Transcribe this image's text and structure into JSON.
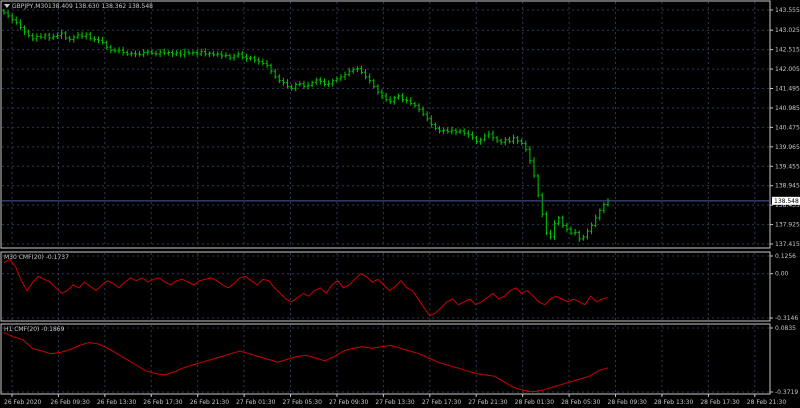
{
  "window": {
    "symbol_title": "GBPJPY,M30",
    "ohlc_text": "138.409 138.630 138.362 138.548"
  },
  "colors": {
    "background": "#000000",
    "grid": "#2a3a5a",
    "frame": "#c8c8c8",
    "candle": "#00c800",
    "indicator": "#d00000",
    "current_price_line": "#4a5a9a"
  },
  "main_chart": {
    "price_axis_labels": [
      "143.555",
      "143.025",
      "142.515",
      "142.005",
      "141.495",
      "140.985",
      "140.475",
      "139.965",
      "139.455",
      "138.945",
      "138.435",
      "137.925",
      "137.415"
    ],
    "price_range": [
      137.415,
      143.555
    ],
    "current_price": "138.548",
    "closes": [
      143.48,
      143.4,
      143.3,
      143.22,
      143.1,
      142.98,
      142.88,
      142.8,
      142.86,
      142.84,
      142.9,
      142.82,
      142.86,
      142.88,
      142.95,
      142.82,
      142.78,
      142.84,
      142.9,
      142.86,
      142.92,
      142.8,
      142.78,
      142.76,
      142.7,
      142.58,
      142.5,
      142.48,
      142.5,
      142.44,
      142.4,
      142.42,
      142.4,
      142.38,
      142.44,
      142.46,
      142.42,
      142.4,
      142.45,
      142.42,
      142.44,
      142.4,
      142.43,
      142.38,
      142.45,
      142.42,
      142.44,
      142.4,
      142.46,
      142.4,
      142.42,
      142.38,
      142.4,
      142.35,
      142.36,
      142.3,
      142.35,
      142.4,
      142.32,
      142.28,
      142.3,
      142.24,
      142.2,
      142.15,
      142.1,
      141.95,
      141.8,
      141.7,
      141.65,
      141.55,
      141.5,
      141.6,
      141.62,
      141.55,
      141.58,
      141.65,
      141.72,
      141.68,
      141.6,
      141.62,
      141.7,
      141.75,
      141.8,
      141.86,
      141.95,
      142.0,
      142.02,
      141.92,
      141.8,
      141.7,
      141.55,
      141.4,
      141.3,
      141.2,
      141.15,
      141.25,
      141.3,
      141.2,
      141.18,
      141.1,
      141.05,
      140.95,
      140.82,
      140.7,
      140.55,
      140.45,
      140.38,
      140.4,
      140.36,
      140.4,
      140.35,
      140.38,
      140.32,
      140.28,
      140.2,
      140.1,
      140.15,
      140.25,
      140.3,
      140.2,
      140.12,
      140.08,
      140.15,
      140.1,
      140.2,
      140.12,
      140.05,
      139.9,
      139.6,
      139.2,
      138.7,
      138.2,
      137.7,
      137.6,
      137.95,
      138.1,
      137.9,
      137.8,
      137.7,
      137.72,
      137.55,
      137.6,
      137.75,
      137.9,
      138.1,
      138.3,
      138.45,
      138.548
    ]
  },
  "x_axis": {
    "labels": [
      "26 Feb 2020",
      "26 Feb 09:30",
      "26 Feb 13:30",
      "26 Feb 17:30",
      "26 Feb 21:30",
      "27 Feb 01:30",
      "27 Feb 05:30",
      "27 Feb 09:30",
      "27 Feb 13:30",
      "27 Feb 17:30",
      "27 Feb 21:30",
      "28 Feb 01:30",
      "28 Feb 05:30",
      "28 Feb 09:30",
      "28 Feb 13:30",
      "28 Feb 17:30",
      "28 Feb 21:30"
    ]
  },
  "cmf_m30": {
    "title": "M30 CMF(20) -0.1737",
    "axis_labels": [
      "0.1256",
      "0.00",
      "-0.3146"
    ],
    "range": [
      -0.3146,
      0.1256
    ],
    "values": [
      0.08,
      0.1,
      0.05,
      -0.05,
      -0.12,
      -0.06,
      -0.02,
      -0.04,
      -0.06,
      -0.1,
      -0.14,
      -0.12,
      -0.08,
      -0.1,
      -0.06,
      -0.09,
      -0.12,
      -0.08,
      -0.05,
      -0.07,
      -0.1,
      -0.06,
      -0.03,
      -0.05,
      -0.03,
      -0.06,
      -0.04,
      -0.03,
      -0.06,
      -0.08,
      -0.05,
      -0.04,
      -0.06,
      -0.08,
      -0.05,
      -0.04,
      -0.03,
      -0.05,
      -0.08,
      -0.1,
      -0.07,
      -0.03,
      -0.02,
      -0.05,
      -0.08,
      -0.04,
      -0.05,
      -0.1,
      -0.14,
      -0.18,
      -0.2,
      -0.17,
      -0.14,
      -0.16,
      -0.12,
      -0.1,
      -0.14,
      -0.08,
      -0.05,
      -0.1,
      -0.08,
      -0.04,
      0.0,
      -0.02,
      -0.06,
      -0.04,
      -0.08,
      -0.12,
      -0.09,
      -0.05,
      -0.1,
      -0.12,
      -0.18,
      -0.24,
      -0.3,
      -0.28,
      -0.24,
      -0.2,
      -0.18,
      -0.22,
      -0.2,
      -0.18,
      -0.22,
      -0.2,
      -0.17,
      -0.14,
      -0.18,
      -0.16,
      -0.12,
      -0.1,
      -0.14,
      -0.12,
      -0.16,
      -0.2,
      -0.22,
      -0.18,
      -0.16,
      -0.18,
      -0.2,
      -0.18,
      -0.2,
      -0.22,
      -0.16,
      -0.2,
      -0.18,
      -0.17
    ]
  },
  "cmf_h1": {
    "title": "H1 CMF(20) -0.1869",
    "axis_labels": [
      "0.0835",
      "-0.3719"
    ],
    "range": [
      -0.3719,
      0.0835
    ],
    "values": [
      0.05,
      0.02,
      0.0,
      -0.06,
      -0.08,
      -0.1,
      -0.09,
      -0.07,
      -0.04,
      -0.02,
      -0.03,
      -0.06,
      -0.1,
      -0.14,
      -0.18,
      -0.22,
      -0.24,
      -0.25,
      -0.23,
      -0.2,
      -0.18,
      -0.16,
      -0.14,
      -0.12,
      -0.1,
      -0.08,
      -0.1,
      -0.12,
      -0.14,
      -0.16,
      -0.14,
      -0.12,
      -0.11,
      -0.13,
      -0.15,
      -0.12,
      -0.08,
      -0.06,
      -0.05,
      -0.06,
      -0.05,
      -0.04,
      -0.06,
      -0.08,
      -0.1,
      -0.13,
      -0.16,
      -0.18,
      -0.2,
      -0.22,
      -0.24,
      -0.25,
      -0.26,
      -0.3,
      -0.34,
      -0.36,
      -0.37,
      -0.36,
      -0.34,
      -0.32,
      -0.3,
      -0.28,
      -0.26,
      -0.22,
      -0.2
    ]
  }
}
